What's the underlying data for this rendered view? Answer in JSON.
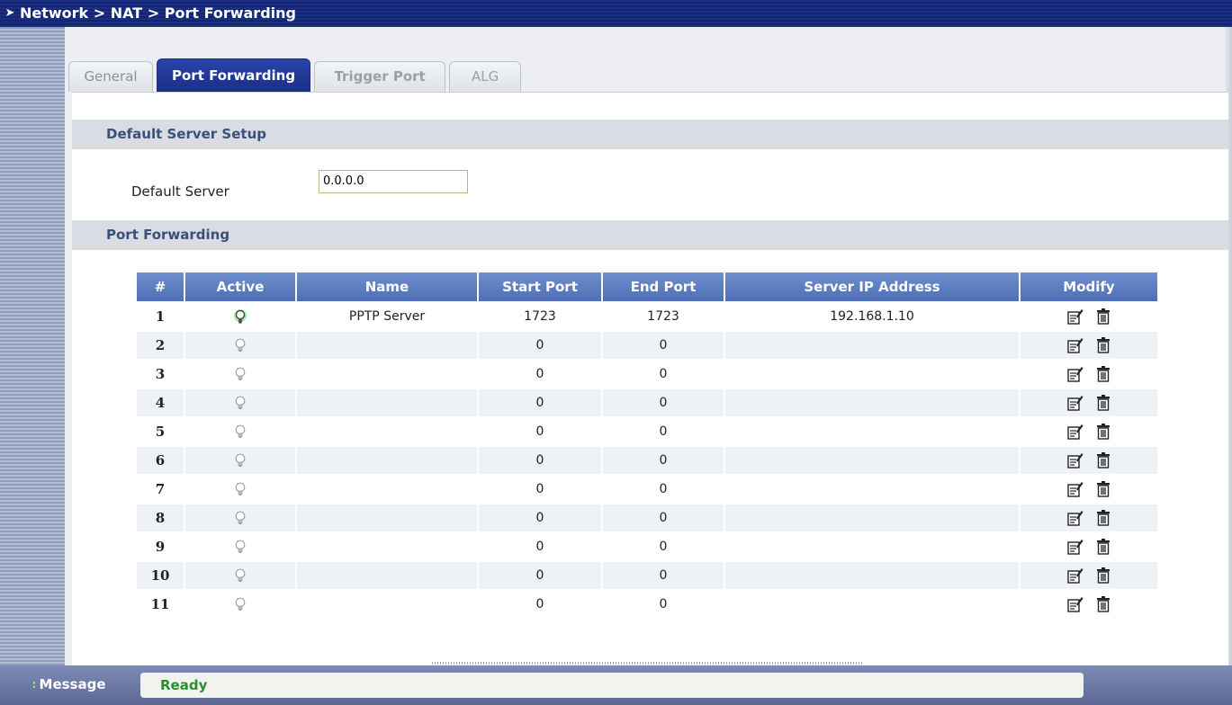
{
  "breadcrumb": "Network > NAT > Port Forwarding",
  "tabs": [
    {
      "label": "General"
    },
    {
      "label": "Port Forwarding"
    },
    {
      "label": "Trigger Port"
    },
    {
      "label": "ALG"
    }
  ],
  "default_server_section": {
    "title": "Default Server Setup",
    "label": "Default Server",
    "value": "0.0.0.0"
  },
  "port_forwarding_section": {
    "title": "Port Forwarding"
  },
  "table": {
    "headers": [
      "#",
      "Active",
      "Name",
      "Start Port",
      "End Port",
      "Server IP Address",
      "Modify"
    ],
    "rows": [
      {
        "num": "1",
        "active": true,
        "name": "PPTP Server",
        "start": "1723",
        "end": "1723",
        "ip": "192.168.1.10"
      },
      {
        "num": "2",
        "active": false,
        "name": "",
        "start": "0",
        "end": "0",
        "ip": ""
      },
      {
        "num": "3",
        "active": false,
        "name": "",
        "start": "0",
        "end": "0",
        "ip": ""
      },
      {
        "num": "4",
        "active": false,
        "name": "",
        "start": "0",
        "end": "0",
        "ip": ""
      },
      {
        "num": "5",
        "active": false,
        "name": "",
        "start": "0",
        "end": "0",
        "ip": ""
      },
      {
        "num": "6",
        "active": false,
        "name": "",
        "start": "0",
        "end": "0",
        "ip": ""
      },
      {
        "num": "7",
        "active": false,
        "name": "",
        "start": "0",
        "end": "0",
        "ip": ""
      },
      {
        "num": "8",
        "active": false,
        "name": "",
        "start": "0",
        "end": "0",
        "ip": ""
      },
      {
        "num": "9",
        "active": false,
        "name": "",
        "start": "0",
        "end": "0",
        "ip": ""
      },
      {
        "num": "10",
        "active": false,
        "name": "",
        "start": "0",
        "end": "0",
        "ip": ""
      },
      {
        "num": "11",
        "active": false,
        "name": "",
        "start": "0",
        "end": "0",
        "ip": ""
      }
    ]
  },
  "message_bar": {
    "label": "Message",
    "status": "Ready"
  },
  "icons": {
    "active_bulb": "lightbulb-on-icon",
    "inactive_bulb": "lightbulb-off-icon",
    "edit": "edit-icon",
    "delete": "trash-icon"
  },
  "colors": {
    "titlebar": "#1b2f85",
    "active_tab": "#1f3594",
    "table_header": "#5a7bbf",
    "status_ready": "#2c8d2c"
  }
}
